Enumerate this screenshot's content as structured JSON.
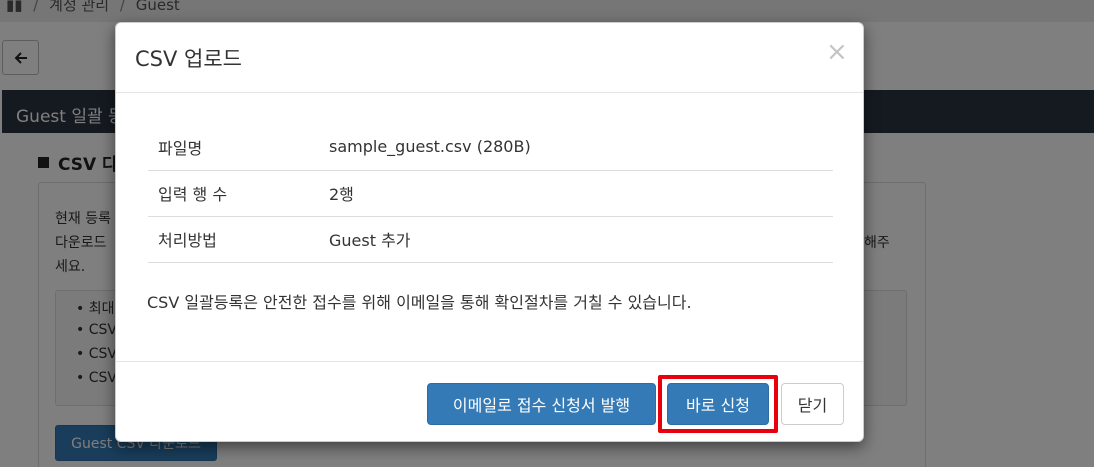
{
  "background": {
    "breadcrumb": [
      "계정 관리",
      "Guest"
    ],
    "section_header": "Guest 일괄 등",
    "section_title": "CSV 다",
    "desc_lines": [
      "현재 등록",
      "다운로드",
      "세요."
    ],
    "desc_right": "해주",
    "bullets": [
      "• 최대",
      "• CSV",
      "• CSV",
      "• CSV"
    ],
    "download_button": "Guest CSV 다운로드"
  },
  "modal": {
    "title": "CSV 업로드",
    "close_symbol": "×",
    "rows": [
      {
        "label": "파일명",
        "value": "sample_guest.csv (280B)"
      },
      {
        "label": "입력 행 수",
        "value": "2행"
      },
      {
        "label": "처리방법",
        "value": "Guest 추가"
      }
    ],
    "notice": "CSV 일괄등록은 안전한 접수를 위해 이메일을 통해 확인절차를 거칠 수 있습니다.",
    "buttons": {
      "email": "이메일로 접수 신청서 발행",
      "apply": "바로 신청",
      "close": "닫기"
    }
  },
  "colors": {
    "primary": "#337ab7",
    "header_dark": "#2b3442",
    "highlight": "#e8000d"
  }
}
